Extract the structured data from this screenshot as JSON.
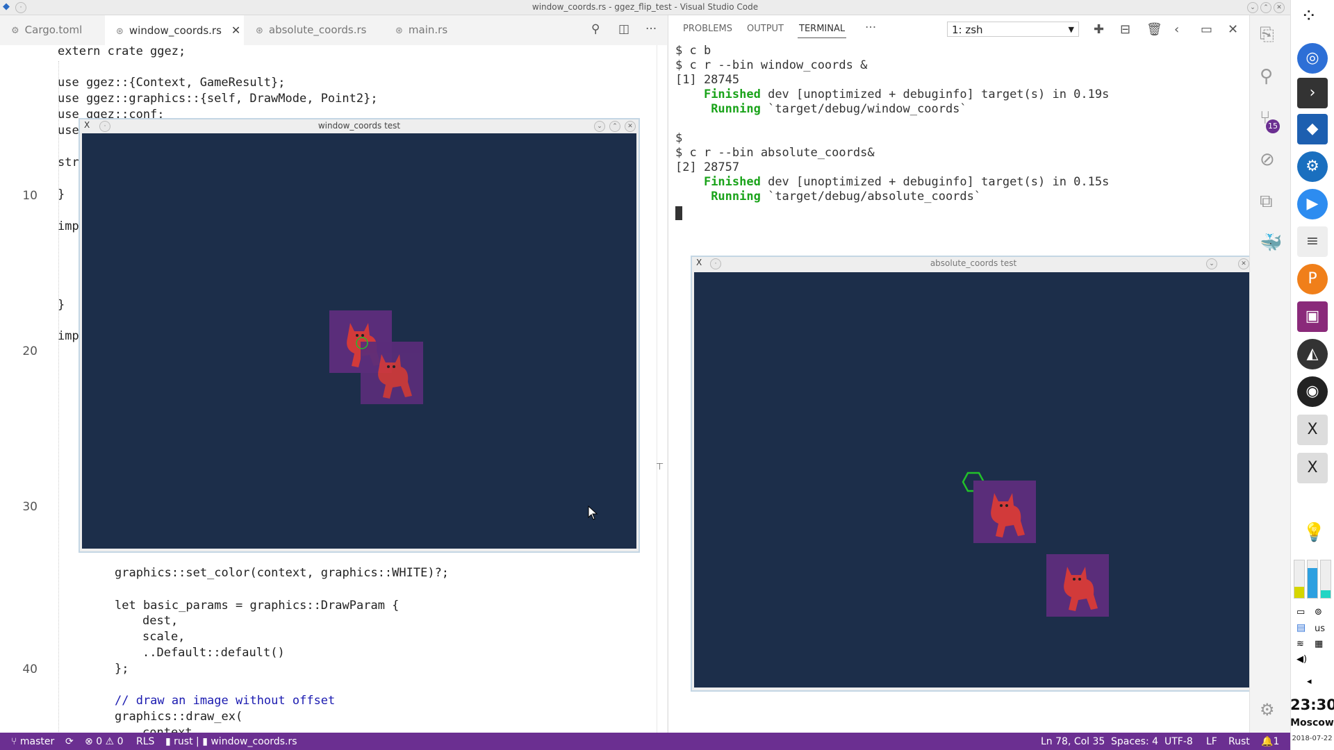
{
  "window": {
    "title": "window_coords.rs - ggez_flip_test - Visual Studio Code"
  },
  "tabs": [
    {
      "label": "Cargo.toml",
      "icon": "gear-icon"
    },
    {
      "label": "window_coords.rs",
      "icon": "rust-icon",
      "active": true
    },
    {
      "label": "absolute_coords.rs",
      "icon": "rust-icon"
    },
    {
      "label": "main.rs",
      "icon": "rust-icon"
    }
  ],
  "editor": {
    "line_numbers": [
      "10",
      "20",
      "30",
      "40"
    ],
    "lines": {
      "l1": "extern crate ggez;",
      "l3": "use ggez::{Context, GameResult};",
      "l4": "use ggez::graphics::{self, DrawMode, Point2};",
      "l5": "use ggez::conf;",
      "l6": "use",
      "l8": "str",
      "l10": "}",
      "l12": "imp",
      "l17": "}",
      "l19": "imp",
      "l33": "graphics::set_color(context, graphics::WHITE)?;",
      "l35": "let basic_params = graphics::DrawParam {",
      "l36": "dest,",
      "l37": "scale,",
      "l38": "..Default::default()",
      "l39": "};",
      "l41": "// draw an image without offset",
      "l42": "graphics::draw_ex(",
      "l43": "context,"
    }
  },
  "panel": {
    "tabs": [
      "PROBLEMS",
      "OUTPUT",
      "TERMINAL"
    ],
    "more": "···",
    "terminal_select": "1: zsh"
  },
  "terminal": {
    "lines": [
      "$ c b",
      "$ c r --bin window_coords &",
      "[1] 28745",
      "    Finished dev [unoptimized + debuginfo] target(s) in 0.19s",
      "     Running `target/debug/window_coords`",
      "",
      "$",
      "$ c r --bin absolute_coords&",
      "[2] 28757",
      "    Finished dev [unoptimized + debuginfo] target(s) in 0.15s",
      "     Running `target/debug/absolute_coords`"
    ],
    "finished_word": "Finished",
    "running_word": "Running"
  },
  "windows": {
    "window_coords": {
      "title": "window_coords test"
    },
    "absolute_coords": {
      "title": "absolute_coords test"
    }
  },
  "dock": {
    "clock": "23:30",
    "timezone": "Moscow",
    "date": "2018-07-22",
    "keyboard": "us",
    "badge": "15"
  },
  "statusbar": {
    "branch": "master",
    "errors": "0",
    "warnings": "0",
    "rls": "RLS",
    "rust_label": "rust",
    "file": "window_coords.rs",
    "position": "Ln 78, Col 35",
    "spaces": "Spaces: 4",
    "encoding": "UTF-8",
    "eol": "LF",
    "language": "Rust",
    "notifications": "1"
  },
  "colors": {
    "statusbar": "#6b2f91",
    "canvas": "#1c2e4a",
    "sprite_bg": "#5a2d7a",
    "sprite_fg": "#d23a3a",
    "marker": "#22c02a",
    "terminal_green": "#1aa31a"
  }
}
